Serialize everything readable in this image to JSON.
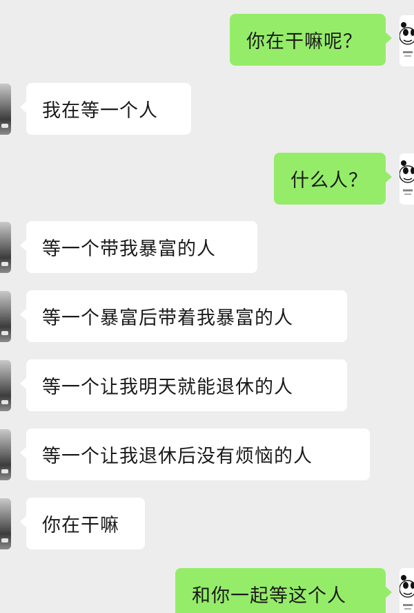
{
  "messages": [
    {
      "side": "right",
      "text": "你在干嘛呢？"
    },
    {
      "side": "left",
      "text": "我在等一个人"
    },
    {
      "side": "right",
      "text": "什么人？"
    },
    {
      "side": "left",
      "text": "等一个带我暴富的人"
    },
    {
      "side": "left",
      "text": "等一个暴富后带着我暴富的人"
    },
    {
      "side": "left",
      "text": "等一个让我明天就能退休的人"
    },
    {
      "side": "left",
      "text": "等一个让我退休后没有烦恼的人"
    },
    {
      "side": "left",
      "text": "你在干嘛"
    },
    {
      "side": "right",
      "text": "和你一起等这个人"
    }
  ],
  "colors": {
    "background": "#ededed",
    "bubble_sent": "#95ec69",
    "bubble_received": "#ffffff"
  },
  "icons": {
    "left_avatar": "avatar-landscape-photo",
    "right_avatar": "avatar-panda-meme"
  }
}
